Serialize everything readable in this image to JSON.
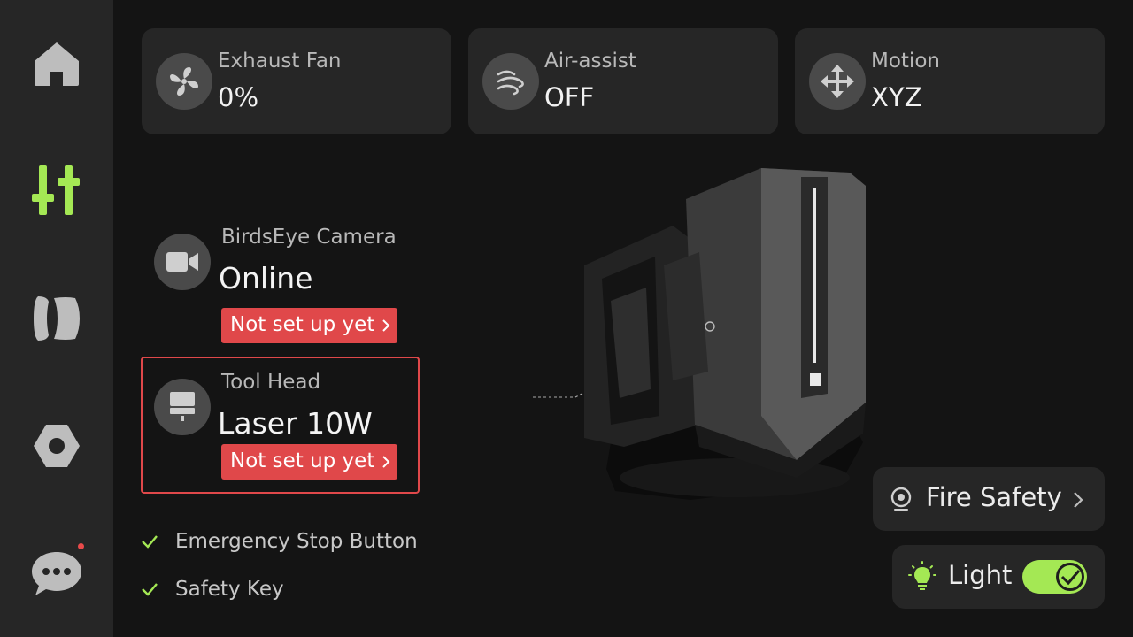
{
  "sidebar": {
    "items": [
      {
        "name": "home",
        "active": false
      },
      {
        "name": "controls",
        "active": true
      },
      {
        "name": "filament",
        "active": false
      },
      {
        "name": "settings",
        "active": false
      },
      {
        "name": "messages",
        "active": false,
        "has_notification": true
      }
    ]
  },
  "status_cards": [
    {
      "label": "Exhaust Fan",
      "value": "0%",
      "icon": "fan-icon"
    },
    {
      "label": "Air-assist",
      "value": "OFF",
      "icon": "wind-icon"
    },
    {
      "label": "Motion",
      "value": "XYZ",
      "icon": "move-arrows-icon"
    }
  ],
  "camera": {
    "label": "BirdsEye Camera",
    "status": "Online",
    "action": "Not set up yet"
  },
  "toolhead": {
    "label": "Tool Head",
    "value": "Laser 10W",
    "action": "Not set up yet"
  },
  "checks": [
    {
      "label": "Emergency Stop Button",
      "ok": true
    },
    {
      "label": "Safety Key",
      "ok": true
    }
  ],
  "fire_safety": {
    "label": "Fire Safety"
  },
  "light": {
    "label": "Light",
    "on": true
  },
  "colors": {
    "accent": "#a4e854",
    "warning": "#e0484a",
    "card": "#262626",
    "background": "#141414"
  }
}
